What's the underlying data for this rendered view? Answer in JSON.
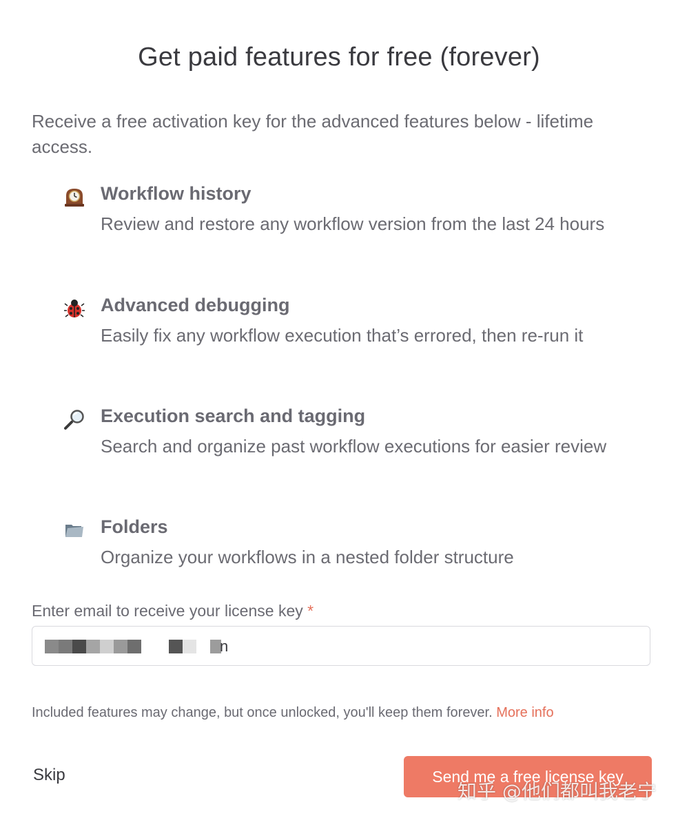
{
  "modal": {
    "title": "Get paid features for free (forever)",
    "intro": "Receive a free activation key for the advanced features below - lifetime access."
  },
  "features": [
    {
      "icon": "mantelpiece-clock-icon",
      "title": "Workflow history",
      "description": "Review and restore any workflow version from the last 24 hours"
    },
    {
      "icon": "ladybug-icon",
      "title": "Advanced debugging",
      "description": "Easily fix any workflow execution that’s errored, then re-run it"
    },
    {
      "icon": "magnifying-glass-icon",
      "title": "Execution search and tagging",
      "description": "Search and organize past workflow executions for easier review"
    },
    {
      "icon": "folder-icon",
      "title": "Folders",
      "description": "Organize your workflows in a nested folder structure"
    }
  ],
  "email": {
    "label": "Enter email to receive your license key",
    "required_marker": "*",
    "visible_value_suffix": "n"
  },
  "disclaimer": {
    "text": "Included features may change, but once unlocked, you'll keep them forever.",
    "link": "More info"
  },
  "actions": {
    "skip": "Skip",
    "send": "Send me a free license key"
  },
  "watermark": "知乎 @他们都叫我老宁",
  "colors": {
    "accent": "#ee7a65",
    "link": "#e5705a",
    "text": "#6a6a72"
  }
}
